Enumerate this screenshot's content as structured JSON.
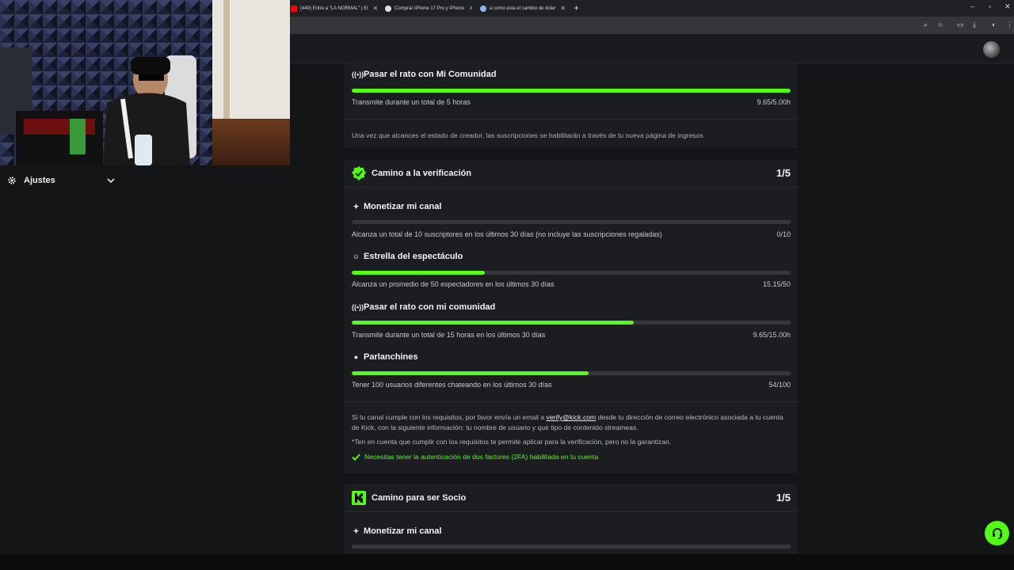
{
  "browser": {
    "tabs": [
      {
        "title": "(449) Entre a \"LA NORMAL\" | El",
        "color": "#ff0000"
      },
      {
        "title": "Comprar iPhone 17 Pro y iPhone",
        "color": "#e0e0e0"
      },
      {
        "title": "a como esta el cambio de dolar",
        "color": "#8ab4f8"
      }
    ],
    "new_tab": "+",
    "close": "✕",
    "window_controls": [
      "–",
      "▫",
      "✕"
    ]
  },
  "sidebar": {
    "settings_label": "Ajustes",
    "icon": "gear-icon",
    "chevron": "chevron-down-icon"
  },
  "top_item": {
    "title": "Pasar el rato con Mi Comunidad",
    "desc": "Transmite durante un total de 5 horas",
    "value": "9.65/5.00h",
    "progress": 1.0
  },
  "creator_note": "Una vez que alcances el estado de creador, las suscripciones se habilitarán a través de tu nueva página de ingresos",
  "verification": {
    "title": "Camino a la verificación",
    "count": "1/5",
    "items": [
      {
        "title": "Monetizar mi canal",
        "icon": "sparkle-icon",
        "desc": "Alcanza un total de 10 suscriptores en los últimos 30 días (no incluye las suscripciones regaladas)",
        "value": "0/10",
        "progress": 0.0
      },
      {
        "title": "Estrella del espectáculo",
        "icon": "viewers-icon",
        "desc": "Alcanza un promedio de 50 espectadores en los últimos 30 días",
        "value": "15.15/50",
        "progress": 0.303
      },
      {
        "title": "Pasar el rato con mi comunidad",
        "icon": "broadcast-icon",
        "desc": "Transmite durante un total de 15 horas en los últimos 30 días",
        "value": "9.65/15.00h",
        "progress": 0.643
      },
      {
        "title": "Parlanchines",
        "icon": "chat-icon",
        "desc": "Tener 100 usuarios diferentes chateando en los últimos 30 días",
        "value": "54/100",
        "progress": 0.54
      }
    ],
    "note_before": "Si tu canal cumple con los requisitos, por favor envía un email a ",
    "email": "verify@kick.com",
    "note_after": " desde tu dirección de correo electrónico asociada a tu cuenta de Kick, con la siguiente información: tu nombre de usuario y qué tipo de contenido streameas.",
    "disclaimer": "*Ten en cuenta que cumplir con los requisitos te permite aplicar para la verificación, pero no la garantizan.",
    "twofa": "Necesitas tener la autenticación de dos factores (2FA) habilitada en tu cuenta"
  },
  "partner": {
    "title": "Camino para ser Socio",
    "count": "1/5",
    "first_item": "Monetizar mi canal",
    "first_progress": 0.0
  },
  "colors": {
    "accent": "#53fc18",
    "panel": "#1b1d20",
    "background": "#141517"
  }
}
